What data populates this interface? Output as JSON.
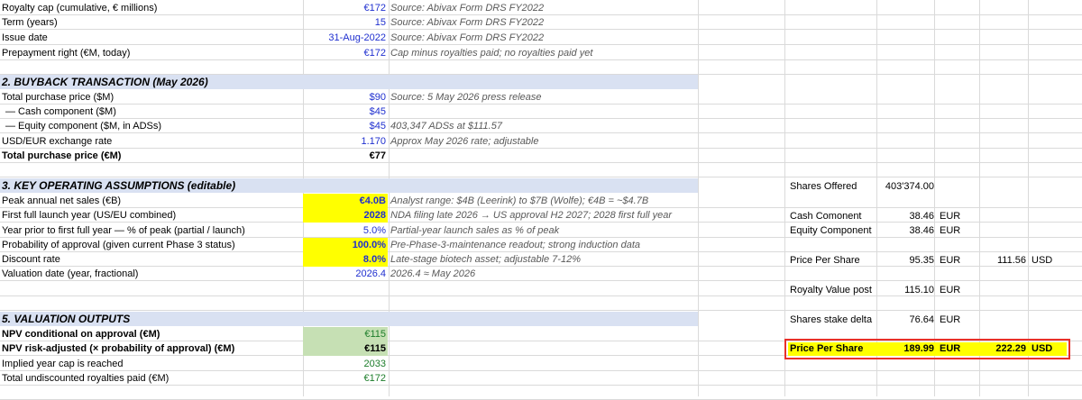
{
  "rows_top": [
    {
      "label": "Royalty cap (cumulative, € millions)",
      "value": "€172",
      "note": "Source: Abivax Form DRS FY2022"
    },
    {
      "label": "Term (years)",
      "value": "15",
      "note": "Source: Abivax Form DRS FY2022"
    },
    {
      "label": "Issue date",
      "value": "31-Aug-2022",
      "note": "Source: Abivax Form DRS FY2022"
    },
    {
      "label": "Prepayment right (€M, today)",
      "value": "€172",
      "note": "Cap minus royalties paid; no royalties paid yet"
    }
  ],
  "section2": {
    "title": "2. BUYBACK TRANSACTION (May 2026)",
    "rows": [
      {
        "label": "Total purchase price ($M)",
        "value": "$90",
        "note": "Source: 5 May 2026 press release"
      },
      {
        "label": "— Cash component ($M)",
        "value": "$45",
        "note": ""
      },
      {
        "label": "— Equity component ($M, in ADSs)",
        "value": "$45",
        "note": "403,347 ADSs at $111.57"
      },
      {
        "label": "USD/EUR exchange rate",
        "value": "1.170",
        "note": "Approx May 2026 rate; adjustable"
      },
      {
        "label": "Total purchase price (€M)",
        "value": "€77",
        "note": ""
      }
    ]
  },
  "section3": {
    "title": "3. KEY OPERATING ASSUMPTIONS (editable)",
    "rows": [
      {
        "label": "Peak annual net sales (€B)",
        "value": "€4.0B",
        "note": "Analyst range: $4B (Leerink) to $7B (Wolfe); €4B = ~$4.7B"
      },
      {
        "label": "First full launch year (US/EU combined)",
        "value": "2028",
        "note": "NDA filing late 2026 → US approval H2 2027; 2028 first full year"
      },
      {
        "label": "Year prior to first full year — % of peak (partial / launch)",
        "value": "5.0%",
        "note": "Partial-year launch sales as % of peak"
      },
      {
        "label": "Probability of approval (given current Phase 3 status)",
        "value": "100.0%",
        "note": "Pre-Phase-3-maintenance readout; strong induction data"
      },
      {
        "label": "Discount rate",
        "value": "8.0%",
        "note": "Late-stage biotech asset; adjustable 7-12%"
      },
      {
        "label": "Valuation date (year, fractional)",
        "value": "2026.4",
        "note": "2026.4 ≈ May 2026"
      }
    ]
  },
  "section5": {
    "title": "5. VALUATION OUTPUTS",
    "rows": [
      {
        "label": "NPV conditional on approval (€M)",
        "value": "€115"
      },
      {
        "label": "NPV risk-adjusted (× probability of approval) (€M)",
        "value": "€115"
      },
      {
        "label": "Implied year cap is reached",
        "value": "2033"
      },
      {
        "label": "Total undiscounted royalties paid (€M)",
        "value": "€172"
      }
    ]
  },
  "side": {
    "shares_offered_label": "Shares Offered",
    "shares_offered_value": "403'374.00",
    "cash_label": "Cash Comonent",
    "cash_value": "38.46",
    "cash_ccy": "EUR",
    "equity_label": "Equity Component",
    "equity_value": "38.46",
    "equity_ccy": "EUR",
    "pps_label": "Price Per Share",
    "pps_eur": "95.35",
    "pps_eur_ccy": "EUR",
    "pps_usd": "111.56",
    "pps_usd_ccy": "USD",
    "royalty_label": "Royalty Value post",
    "royalty_value": "115.10",
    "royalty_ccy": "EUR",
    "stake_label": "Shares stake delta",
    "stake_value": "76.64",
    "stake_ccy": "EUR",
    "pps2_label": "Price Per Share",
    "pps2_eur": "189.99",
    "pps2_eur_ccy": "EUR",
    "pps2_usd": "222.29",
    "pps2_usd_ccy": "USD"
  }
}
